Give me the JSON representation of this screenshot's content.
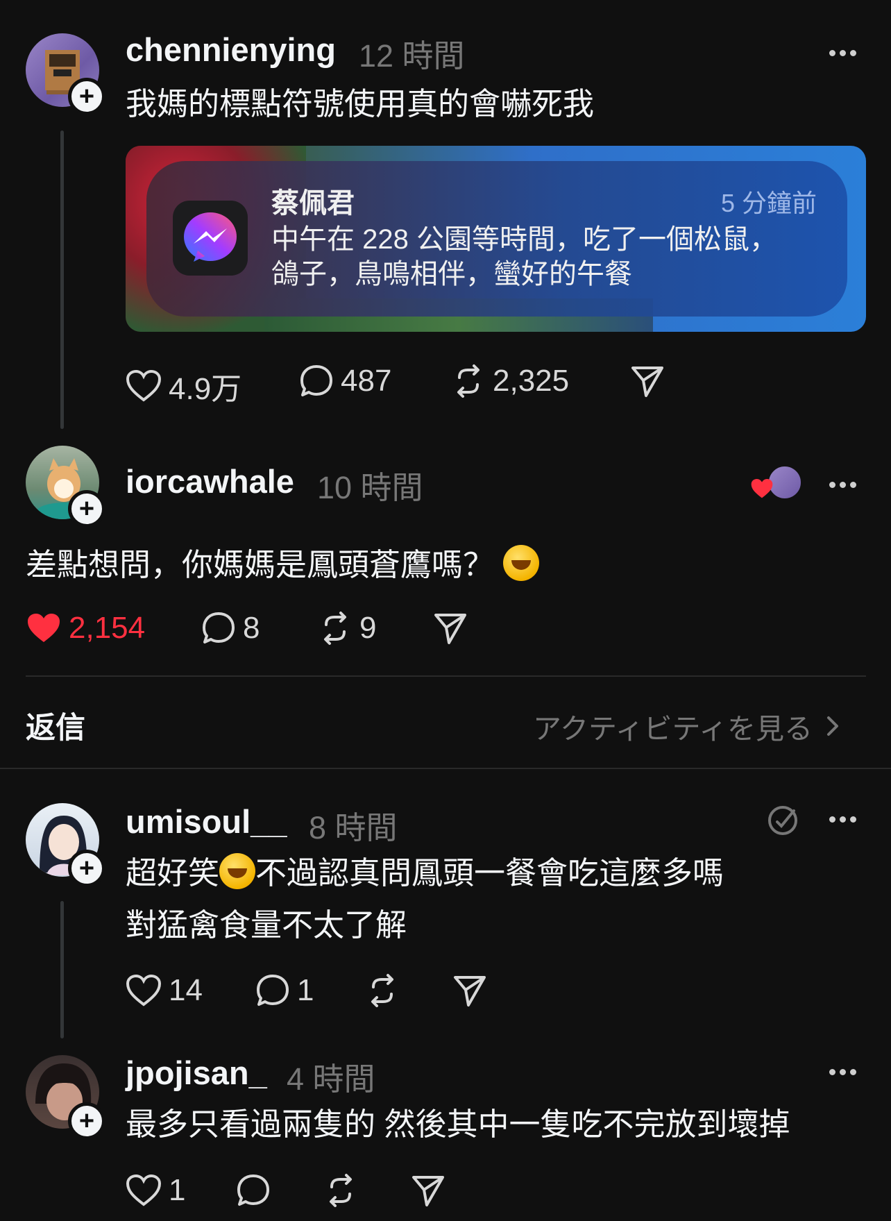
{
  "posts": [
    {
      "username": "chennienying",
      "time": "12 時間",
      "text": "我媽的標點符號使用真的會嚇死我",
      "notification": {
        "sender": "蔡佩君",
        "time": "5 分鐘前",
        "line1": "中午在 228 公園等時間，吃了一個松鼠，",
        "line2": "鴿子，鳥鳴相伴，蠻好的午餐",
        "app_icon": "messenger-icon"
      },
      "likes": "4.9万",
      "comments": "487",
      "reposts": "2,325"
    },
    {
      "username": "iorcawhale",
      "time": "10 時間",
      "text": "差點想問，你媽媽是鳳頭蒼鷹嗎？",
      "emoji": "rolling-laughing-emoji",
      "likes": "2,154",
      "comments": "8",
      "reposts": "9",
      "liked": true
    }
  ],
  "replies_header": {
    "title": "返信",
    "activity_link": "アクティビティを見る"
  },
  "replies": [
    {
      "username": "umisoul__",
      "time": "8 時間",
      "text_a": "超好笑",
      "text_b": "不過認真問鳳頭一餐會吃這麼多嗎",
      "line2": "對猛禽食量不太了解",
      "likes": "14",
      "comments": "1"
    },
    {
      "username": "jpojisan_",
      "time": "4 時間",
      "text": "最多只看過兩隻的 然後其中一隻吃不完放到壞掉",
      "likes": "1"
    }
  ],
  "colors": {
    "background": "#101010",
    "text": "#f3f5f7",
    "secondary": "#777777",
    "like_red": "#ff3040"
  }
}
